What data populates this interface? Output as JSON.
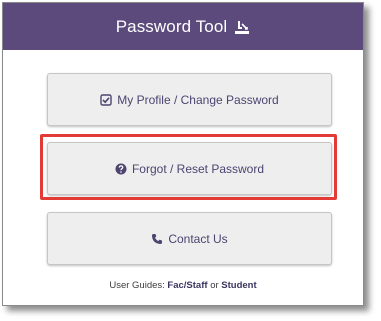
{
  "header": {
    "title": "Password Tool",
    "icon": "user-reset-icon"
  },
  "buttons": {
    "profile": {
      "label": "My Profile / Change Password",
      "icon": "check-square-icon"
    },
    "forgot": {
      "label": "Forgot / Reset Password",
      "icon": "question-circle-icon"
    },
    "contact": {
      "label": "Contact Us",
      "icon": "phone-icon"
    }
  },
  "footer": {
    "prefix": "User Guides:",
    "fac_staff_link": "Fac/Staff",
    "separator": "or",
    "student_link": "Student"
  },
  "colors": {
    "header_bg": "#5b4a7b",
    "button_text": "#4d4470",
    "highlight": "#e43a35"
  }
}
